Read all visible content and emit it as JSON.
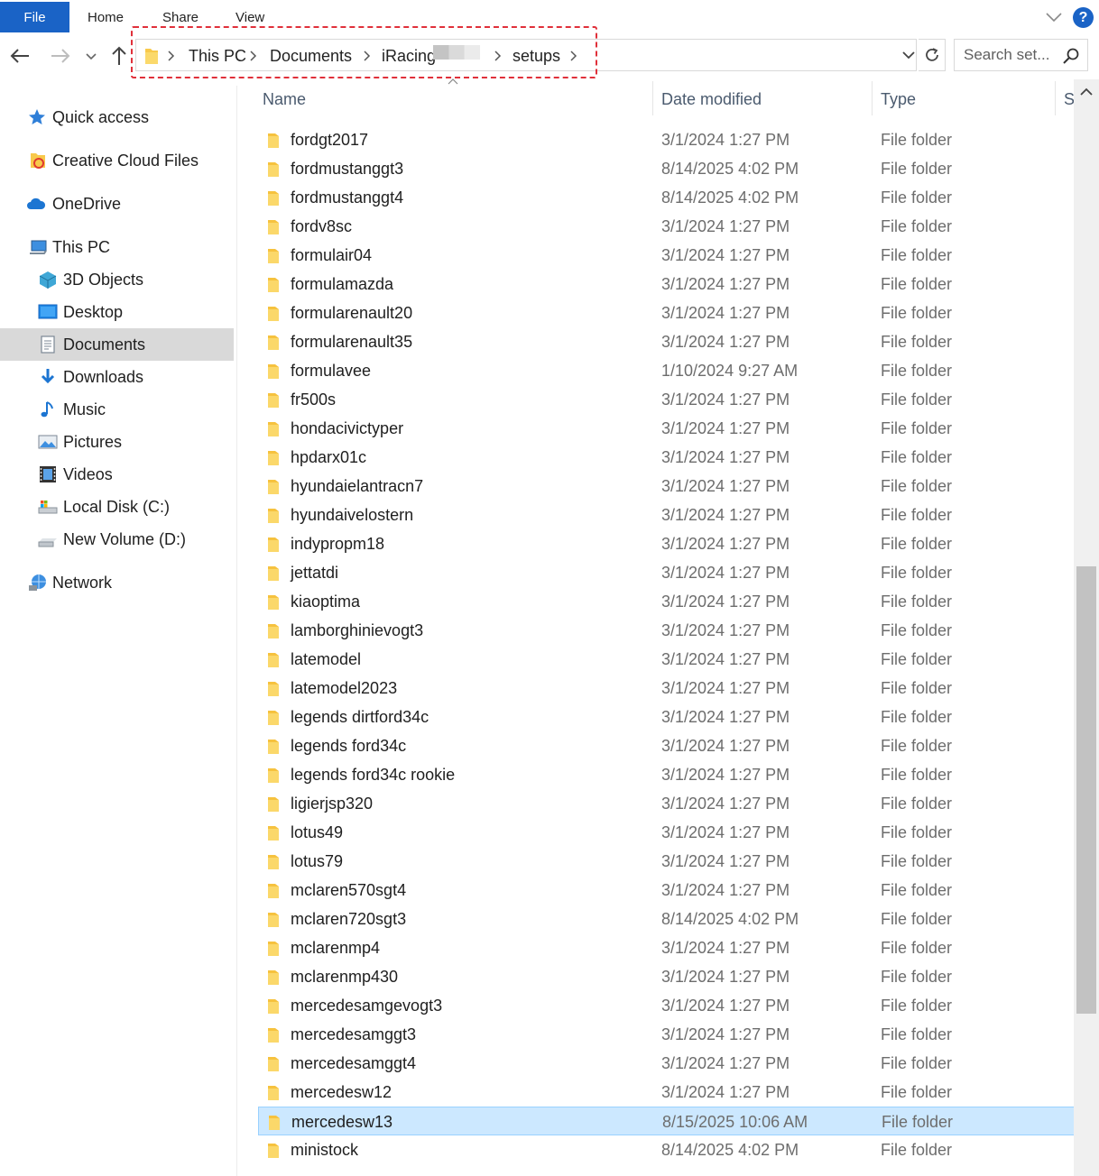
{
  "ribbon": {
    "tabs": [
      {
        "label": "File"
      },
      {
        "label": "Home"
      },
      {
        "label": "Share"
      },
      {
        "label": "View"
      }
    ],
    "help_label": "?"
  },
  "addressbar": {
    "breadcrumbs": [
      "This PC",
      "Documents",
      "iRacing",
      "setups"
    ]
  },
  "search": {
    "placeholder": "Search set..."
  },
  "sidebar": {
    "items": [
      {
        "label": "Quick access",
        "icon": "star-icon"
      },
      {
        "label": "Creative Cloud Files",
        "icon": "creative-cloud-icon"
      },
      {
        "label": "OneDrive",
        "icon": "cloud-icon"
      },
      {
        "label": "This PC",
        "icon": "computer-icon"
      },
      {
        "label": "3D Objects",
        "icon": "cube-icon"
      },
      {
        "label": "Desktop",
        "icon": "desktop-icon"
      },
      {
        "label": "Documents",
        "icon": "document-icon",
        "selected": true
      },
      {
        "label": "Downloads",
        "icon": "download-arrow-icon"
      },
      {
        "label": "Music",
        "icon": "music-note-icon"
      },
      {
        "label": "Pictures",
        "icon": "picture-icon"
      },
      {
        "label": "Videos",
        "icon": "film-icon"
      },
      {
        "label": "Local Disk (C:)",
        "icon": "drive-icon"
      },
      {
        "label": "New Volume (D:)",
        "icon": "drive-icon"
      },
      {
        "label": "Network",
        "icon": "network-icon"
      }
    ]
  },
  "columns": {
    "name": "Name",
    "date": "Date modified",
    "type": "Type",
    "size": "Si"
  },
  "files": [
    {
      "name": "fordgt2017",
      "date": "3/1/2024 1:27 PM",
      "type": "File folder"
    },
    {
      "name": "fordmustanggt3",
      "date": "8/14/2025 4:02 PM",
      "type": "File folder"
    },
    {
      "name": "fordmustanggt4",
      "date": "8/14/2025 4:02 PM",
      "type": "File folder"
    },
    {
      "name": "fordv8sc",
      "date": "3/1/2024 1:27 PM",
      "type": "File folder"
    },
    {
      "name": "formulair04",
      "date": "3/1/2024 1:27 PM",
      "type": "File folder"
    },
    {
      "name": "formulamazda",
      "date": "3/1/2024 1:27 PM",
      "type": "File folder"
    },
    {
      "name": "formularenault20",
      "date": "3/1/2024 1:27 PM",
      "type": "File folder"
    },
    {
      "name": "formularenault35",
      "date": "3/1/2024 1:27 PM",
      "type": "File folder"
    },
    {
      "name": "formulavee",
      "date": "1/10/2024 9:27 AM",
      "type": "File folder"
    },
    {
      "name": "fr500s",
      "date": "3/1/2024 1:27 PM",
      "type": "File folder"
    },
    {
      "name": "hondacivictyper",
      "date": "3/1/2024 1:27 PM",
      "type": "File folder"
    },
    {
      "name": "hpdarx01c",
      "date": "3/1/2024 1:27 PM",
      "type": "File folder"
    },
    {
      "name": "hyundaielantracn7",
      "date": "3/1/2024 1:27 PM",
      "type": "File folder"
    },
    {
      "name": "hyundaivelostern",
      "date": "3/1/2024 1:27 PM",
      "type": "File folder"
    },
    {
      "name": "indypropm18",
      "date": "3/1/2024 1:27 PM",
      "type": "File folder"
    },
    {
      "name": "jettatdi",
      "date": "3/1/2024 1:27 PM",
      "type": "File folder"
    },
    {
      "name": "kiaoptima",
      "date": "3/1/2024 1:27 PM",
      "type": "File folder"
    },
    {
      "name": "lamborghinievogt3",
      "date": "3/1/2024 1:27 PM",
      "type": "File folder"
    },
    {
      "name": "latemodel",
      "date": "3/1/2024 1:27 PM",
      "type": "File folder"
    },
    {
      "name": "latemodel2023",
      "date": "3/1/2024 1:27 PM",
      "type": "File folder"
    },
    {
      "name": "legends dirtford34c",
      "date": "3/1/2024 1:27 PM",
      "type": "File folder"
    },
    {
      "name": "legends ford34c",
      "date": "3/1/2024 1:27 PM",
      "type": "File folder"
    },
    {
      "name": "legends ford34c rookie",
      "date": "3/1/2024 1:27 PM",
      "type": "File folder"
    },
    {
      "name": "ligierjsp320",
      "date": "3/1/2024 1:27 PM",
      "type": "File folder"
    },
    {
      "name": "lotus49",
      "date": "3/1/2024 1:27 PM",
      "type": "File folder"
    },
    {
      "name": "lotus79",
      "date": "3/1/2024 1:27 PM",
      "type": "File folder"
    },
    {
      "name": "mclaren570sgt4",
      "date": "3/1/2024 1:27 PM",
      "type": "File folder"
    },
    {
      "name": "mclaren720sgt3",
      "date": "8/14/2025 4:02 PM",
      "type": "File folder"
    },
    {
      "name": "mclarenmp4",
      "date": "3/1/2024 1:27 PM",
      "type": "File folder"
    },
    {
      "name": "mclarenmp430",
      "date": "3/1/2024 1:27 PM",
      "type": "File folder"
    },
    {
      "name": "mercedesamgevogt3",
      "date": "3/1/2024 1:27 PM",
      "type": "File folder"
    },
    {
      "name": "mercedesamggt3",
      "date": "3/1/2024 1:27 PM",
      "type": "File folder"
    },
    {
      "name": "mercedesamggt4",
      "date": "3/1/2024 1:27 PM",
      "type": "File folder"
    },
    {
      "name": "mercedesw12",
      "date": "3/1/2024 1:27 PM",
      "type": "File folder"
    },
    {
      "name": "mercedesw13",
      "date": "8/15/2025 10:06 AM",
      "type": "File folder",
      "selected": true
    },
    {
      "name": "ministock",
      "date": "8/14/2025 4:02 PM",
      "type": "File folder"
    }
  ],
  "colors": {
    "accent": "#1a63c6",
    "selection_bg": "#cce8ff",
    "selection_border": "#99d1ff",
    "sidebar_selected": "#d9d9d9",
    "folder": "#f8c94b",
    "highlight": "#e0303a"
  }
}
